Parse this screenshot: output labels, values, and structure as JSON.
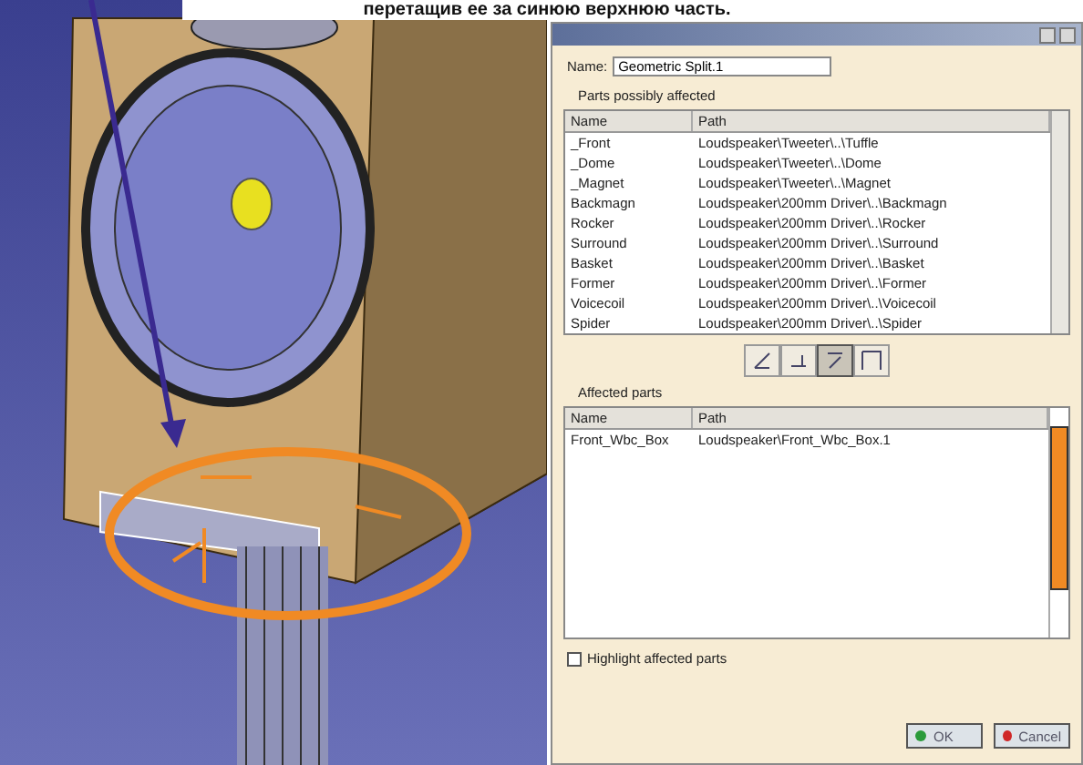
{
  "caption": "перетащив ее за синюю верхнюю часть.",
  "dialog": {
    "name_label": "Name:",
    "name_value": "Geometric Split.1",
    "possibly_affected": {
      "title": "Parts possibly affected",
      "columns": [
        "Name",
        "Path"
      ],
      "rows": [
        {
          "name": "_Front",
          "path": "Loudspeaker\\Tweeter\\..\\Tuffle"
        },
        {
          "name": "_Dome",
          "path": "Loudspeaker\\Tweeter\\..\\Dome"
        },
        {
          "name": "_Magnet",
          "path": "Loudspeaker\\Tweeter\\..\\Magnet"
        },
        {
          "name": "Backmagn",
          "path": "Loudspeaker\\200mm Driver\\..\\Backmagn"
        },
        {
          "name": "Rocker",
          "path": "Loudspeaker\\200mm Driver\\..\\Rocker"
        },
        {
          "name": "Surround",
          "path": "Loudspeaker\\200mm Driver\\..\\Surround"
        },
        {
          "name": "Basket",
          "path": "Loudspeaker\\200mm Driver\\..\\Basket"
        },
        {
          "name": "Former",
          "path": "Loudspeaker\\200mm Driver\\..\\Former"
        },
        {
          "name": "Voicecoil",
          "path": "Loudspeaker\\200mm Driver\\..\\Voicecoil"
        },
        {
          "name": "Spider",
          "path": "Loudspeaker\\200mm Driver\\..\\Spider"
        }
      ]
    },
    "tools": [
      {
        "selected": false
      },
      {
        "selected": false
      },
      {
        "selected": true
      },
      {
        "selected": false
      }
    ],
    "affected": {
      "title": "Affected parts",
      "columns": [
        "Name",
        "Path"
      ],
      "rows": [
        {
          "name": "Front_Wbc_Box",
          "path": "Loudspeaker\\Front_Wbc_Box.1"
        }
      ]
    },
    "highlight": {
      "label": "Highlight affected parts",
      "checked": false
    },
    "buttons": [
      {
        "label": "OK",
        "kind": "ok"
      },
      {
        "label": "Cancel",
        "kind": "cancel"
      }
    ]
  }
}
